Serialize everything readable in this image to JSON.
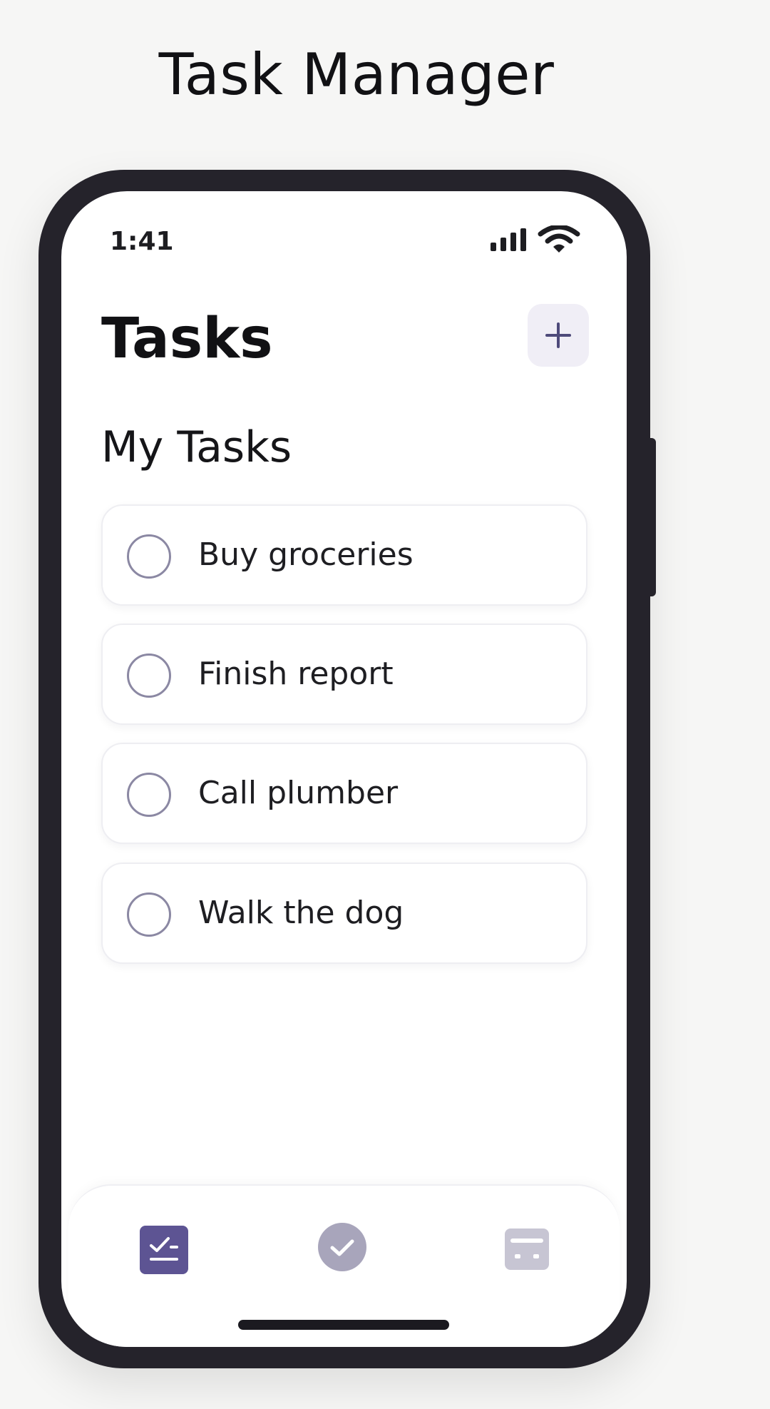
{
  "page": {
    "heading": "Task Manager"
  },
  "status_bar": {
    "time": "1:41",
    "signal_icon": "signal-bars-icon",
    "wifi_icon": "wifi-icon"
  },
  "header": {
    "title": "Tasks",
    "add_icon": "plus-icon"
  },
  "section": {
    "title": "My Tasks"
  },
  "tasks": [
    {
      "label": "Buy groceries",
      "completed": false
    },
    {
      "label": "Finish report",
      "completed": false
    },
    {
      "label": "Call plumber",
      "completed": false
    },
    {
      "label": "Walk the dog",
      "completed": false
    }
  ],
  "tab_bar": {
    "tabs": [
      {
        "icon": "checklist-icon",
        "active": true
      },
      {
        "icon": "check-circle-icon",
        "active": false
      },
      {
        "icon": "calendar-icon",
        "active": false
      }
    ]
  },
  "colors": {
    "accent": "#5d5493",
    "muted_accent": "#a8a5bb",
    "inactive_icon": "#c7c5d3",
    "background": "#f6f6f5",
    "phone_frame": "#25232b"
  }
}
